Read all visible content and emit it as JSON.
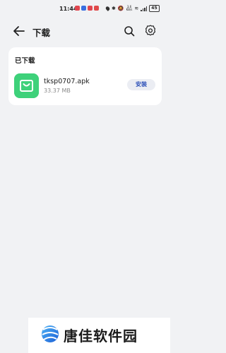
{
  "status_bar": {
    "time": "11:44",
    "net_speed": "3.6\nKB/s",
    "battery": "45"
  },
  "header": {
    "title": "下载"
  },
  "downloaded": {
    "section_title": "已下载",
    "items": [
      {
        "file_name": "tksp0707.apk",
        "file_size": "33.37 MB",
        "action_label": "安装"
      }
    ]
  },
  "watermark": {
    "text": "唐佳软件园"
  },
  "colors": {
    "background": "#f1f2f4",
    "card": "#ffffff",
    "app_icon": "#3ed17a",
    "install_text": "#2c50b8",
    "install_bg": "#ebedf3"
  }
}
